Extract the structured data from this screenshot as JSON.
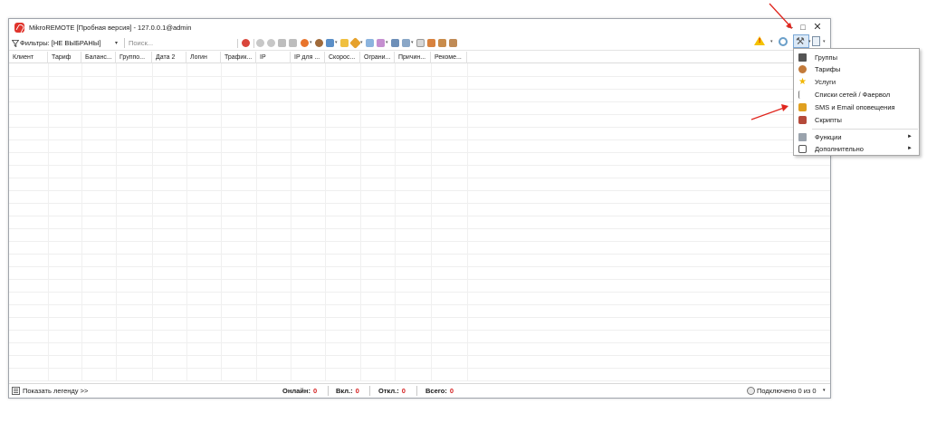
{
  "window": {
    "title": "MikroREMOTE [Пробная версия] - 127.0.0.1@admin",
    "controls": {
      "minimize": "–",
      "maximize": "□",
      "close": "✕"
    }
  },
  "toolbar": {
    "filter_label": "Фильтры: [НЕ ВЫБРАНЫ]",
    "filter_dropdown": "▾",
    "search_placeholder": "Поиск..."
  },
  "table": {
    "columns": [
      "Клиент",
      "Тариф",
      "Баланс...",
      "Группо...",
      "Дата 2",
      "Логин",
      "Трафик...",
      "IP",
      "IP для ...",
      "Скорос...",
      "Ограни...",
      "Причин...",
      "Рекоме..."
    ]
  },
  "menu": {
    "items": [
      {
        "label": "Группы",
        "icon": "groups-icon"
      },
      {
        "label": "Тарифы",
        "icon": "tariffs-icon"
      },
      {
        "label": "Услуги",
        "icon": "services-star-icon"
      },
      {
        "label": "Списки сетей / Фаервол",
        "icon": "network-lists-icon"
      },
      {
        "label": "SMS и Email оповещения",
        "icon": "sms-email-icon"
      },
      {
        "label": "Скрипты",
        "icon": "scripts-icon"
      },
      {
        "label": "Функции",
        "icon": "functions-wrench-icon",
        "submenu": "►"
      },
      {
        "label": "Дополнительно",
        "icon": "additional-icon",
        "submenu": "►"
      }
    ]
  },
  "statusbar": {
    "legend_label": "Показать легенду >>",
    "online_label": "Онлайн:",
    "online_value": "0",
    "on_label": "Вкл.:",
    "on_value": "0",
    "off_label": "Откл.:",
    "off_value": "0",
    "total_label": "Всего:",
    "total_value": "0",
    "connected_label": "Подключено 0 из 0",
    "connected_dropdown": "▾"
  },
  "colors": {
    "accent_red": "#d42020",
    "annotation_arrow": "#e0261e",
    "tools_button_bg": "#dbe9f7"
  }
}
